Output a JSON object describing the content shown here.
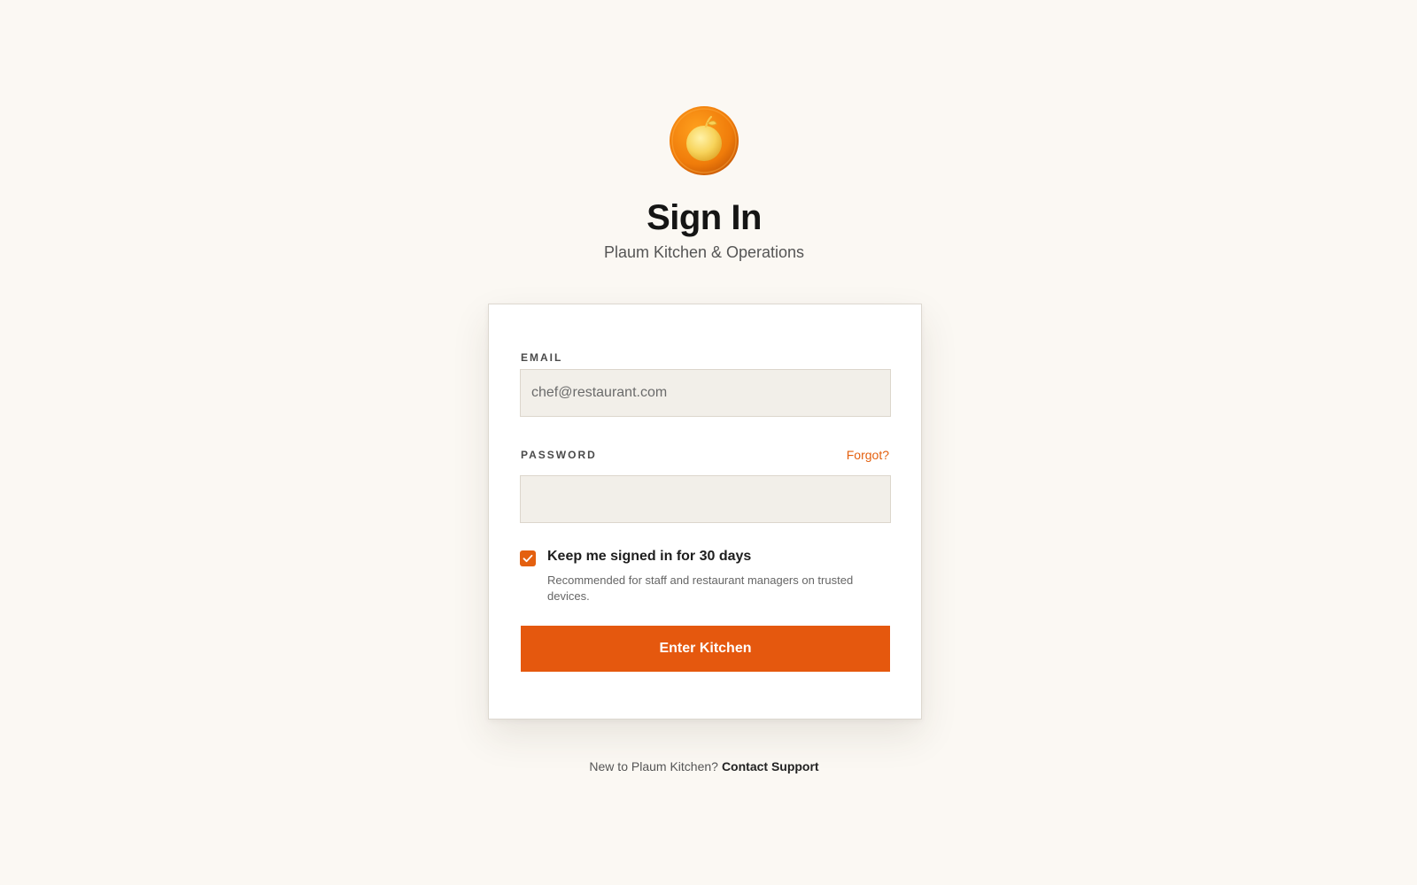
{
  "header": {
    "logo_icon": "orange-fruit-icon",
    "title": "Sign In",
    "subtitle": "Plaum Kitchen & Operations"
  },
  "form": {
    "email_label": "EMAIL",
    "email_placeholder": "chef@restaurant.com",
    "email_value": "",
    "password_label": "PASSWORD",
    "password_value": "",
    "forgot_label": "Forgot?",
    "remember": {
      "checked": true,
      "label": "Keep me signed in for 30 days",
      "hint": "Recommended for staff and restaurant managers on trusted devices."
    },
    "submit_label": "Enter Kitchen"
  },
  "footer": {
    "prompt": "New to Plaum Kitchen?",
    "link_label": "Contact Support"
  },
  "colors": {
    "accent": "#e5580e",
    "background": "#fbf8f3",
    "input_bg": "#f2efe9"
  }
}
